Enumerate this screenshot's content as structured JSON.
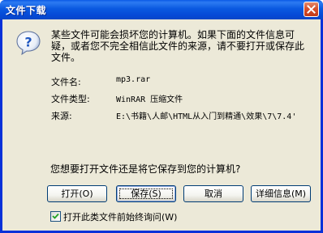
{
  "window": {
    "title": "文件下载"
  },
  "message": "某些文件可能会损坏您的计算机。如果下面的文件信息可疑，或者您不完全相信此文件的来源，请不要打开或保存此文件。",
  "info": {
    "name_label": "文件名:",
    "name_value": "mp3.rar",
    "type_label": "文件类型:",
    "type_value": "WinRAR 压缩文件",
    "source_label": "来源:",
    "source_value": "E:\\书籍\\人邮\\HTML从入门到精通\\效果\\7\\7.4'"
  },
  "prompt": "您想要打开文件还是将它保存到您的计算机?",
  "buttons": {
    "open": "打开(O)",
    "save": "保存(S)",
    "cancel": "取消",
    "details": "详细信息(M)"
  },
  "checkbox": {
    "label": "打开此类文件前始终询问(W)",
    "checked": true
  },
  "colors": {
    "titlebar": "#0a59e0",
    "dialog_bg": "#ece9d8",
    "button_border": "#003c74",
    "icon_blue": "#1e56c0"
  }
}
